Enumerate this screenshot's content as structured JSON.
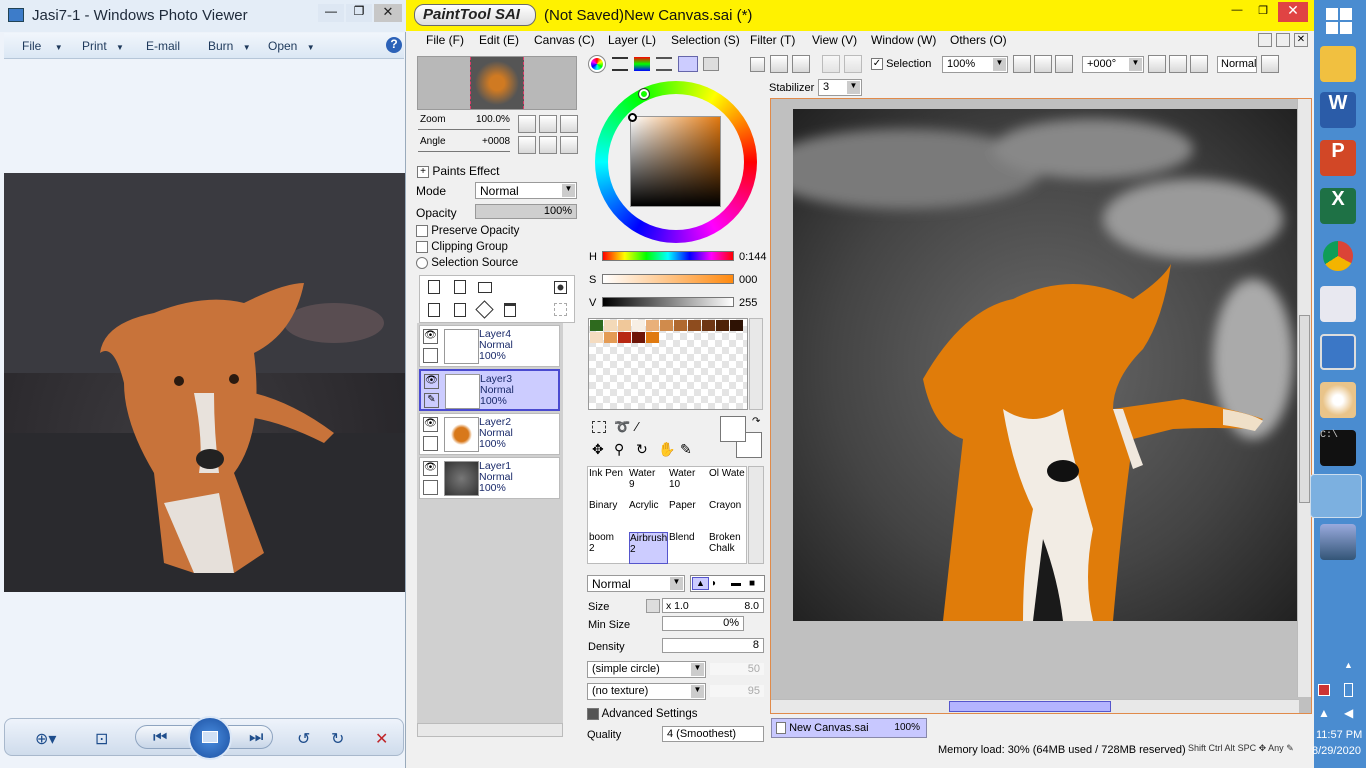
{
  "photo_viewer": {
    "title": "Jasi7-1 - Windows Photo Viewer",
    "menu": [
      "File",
      "Print",
      "E-mail",
      "Burn",
      "Open"
    ],
    "help": "?"
  },
  "sai": {
    "brand": "PaintTool SAI",
    "title": "(Not Saved)New Canvas.sai (*)",
    "menu": [
      "File (F)",
      "Edit (E)",
      "Canvas (C)",
      "Layer (L)",
      "Selection (S)",
      "Filter (T)",
      "View (V)",
      "Window (W)",
      "Others (O)"
    ],
    "nav": {
      "zoom_label": "Zoom",
      "zoom_value": "100.0%",
      "angle_label": "Angle",
      "angle_value": "+0008"
    },
    "layer_props": {
      "paints_effect": "Paints Effect",
      "mode_label": "Mode",
      "mode_value": "Normal",
      "opacity_label": "Opacity",
      "opacity_value": "100%",
      "preserve_opacity": "Preserve Opacity",
      "clipping_group": "Clipping Group",
      "selection_source": "Selection Source"
    },
    "layers": [
      {
        "name": "Layer4",
        "mode": "Normal",
        "opacity": "100%",
        "selected": false
      },
      {
        "name": "Layer3",
        "mode": "Normal",
        "opacity": "100%",
        "selected": true
      },
      {
        "name": "Layer2",
        "mode": "Normal",
        "opacity": "100%",
        "selected": false
      },
      {
        "name": "Layer1",
        "mode": "Normal",
        "opacity": "100%",
        "selected": false
      }
    ],
    "color": {
      "h_label": "H",
      "h_value": "0:144",
      "s_label": "S",
      "s_value": "000",
      "v_label": "V",
      "v_value": "255"
    },
    "swatches": [
      "#2e6a1e",
      "#f3d9b8",
      "#f0c89a",
      "#f7efe4",
      "#e9b07a",
      "#d08b4c",
      "#b0692f",
      "#8e4c1e",
      "#6e3614",
      "#4e2208",
      "#2e1204",
      "#f5dcc0",
      "#e49b54",
      "#b82812",
      "#6e1608",
      "#e07a10"
    ],
    "brushes": [
      {
        "name": "Ink Pen",
        "size": ""
      },
      {
        "name": "Water",
        "size": "9"
      },
      {
        "name": "Water",
        "size": "10"
      },
      {
        "name": "Ol Wate",
        "size": ""
      },
      {
        "name": "Binary",
        "size": ""
      },
      {
        "name": "Acrylic",
        "size": ""
      },
      {
        "name": "Paper",
        "size": ""
      },
      {
        "name": "Crayon",
        "size": ""
      },
      {
        "name": "boom",
        "size": "2"
      },
      {
        "name": "Airbrush",
        "size": "2"
      },
      {
        "name": "Blend",
        "size": ""
      },
      {
        "name": "Broken Chalk",
        "size": ""
      }
    ],
    "brush_settings": {
      "mode": "Normal",
      "size_label": "Size",
      "size_mult": "x 1.0",
      "size_value": "8.0",
      "min_size_label": "Min Size",
      "min_size_value": "0%",
      "density_label": "Density",
      "density_value": "8",
      "shape": "(simple circle)",
      "shape_value": "50",
      "texture": "(no texture)",
      "texture_value": "95",
      "advanced": "Advanced Settings",
      "quality_label": "Quality",
      "quality_value": "4 (Smoothest)"
    },
    "toolbar": {
      "selection_label": "Selection",
      "zoom": "100%",
      "angle": "+000°",
      "blend": "Normal",
      "stabilizer_label": "Stabilizer",
      "stabilizer_value": "3"
    },
    "canvas_tab": {
      "name": "New Canvas.sai",
      "zoom": "100%"
    },
    "status": "Memory load: 30% (64MB used / 728MB reserved)",
    "status_keys": [
      "Shift",
      "Ctrl",
      "Alt",
      "SPC",
      "Any"
    ]
  },
  "clock": {
    "time": "11:57 PM",
    "date": "8/29/2020"
  },
  "taskbar_icons": [
    "start-icon",
    "file-explorer-icon",
    "word-icon",
    "powerpoint-icon",
    "excel-icon",
    "chrome-icon",
    "snipping-tool-icon",
    "remote-desktop-icon",
    "paint-icon",
    "cmd-icon",
    "paint-tool-sai-icon",
    "photo-viewer-icon"
  ]
}
